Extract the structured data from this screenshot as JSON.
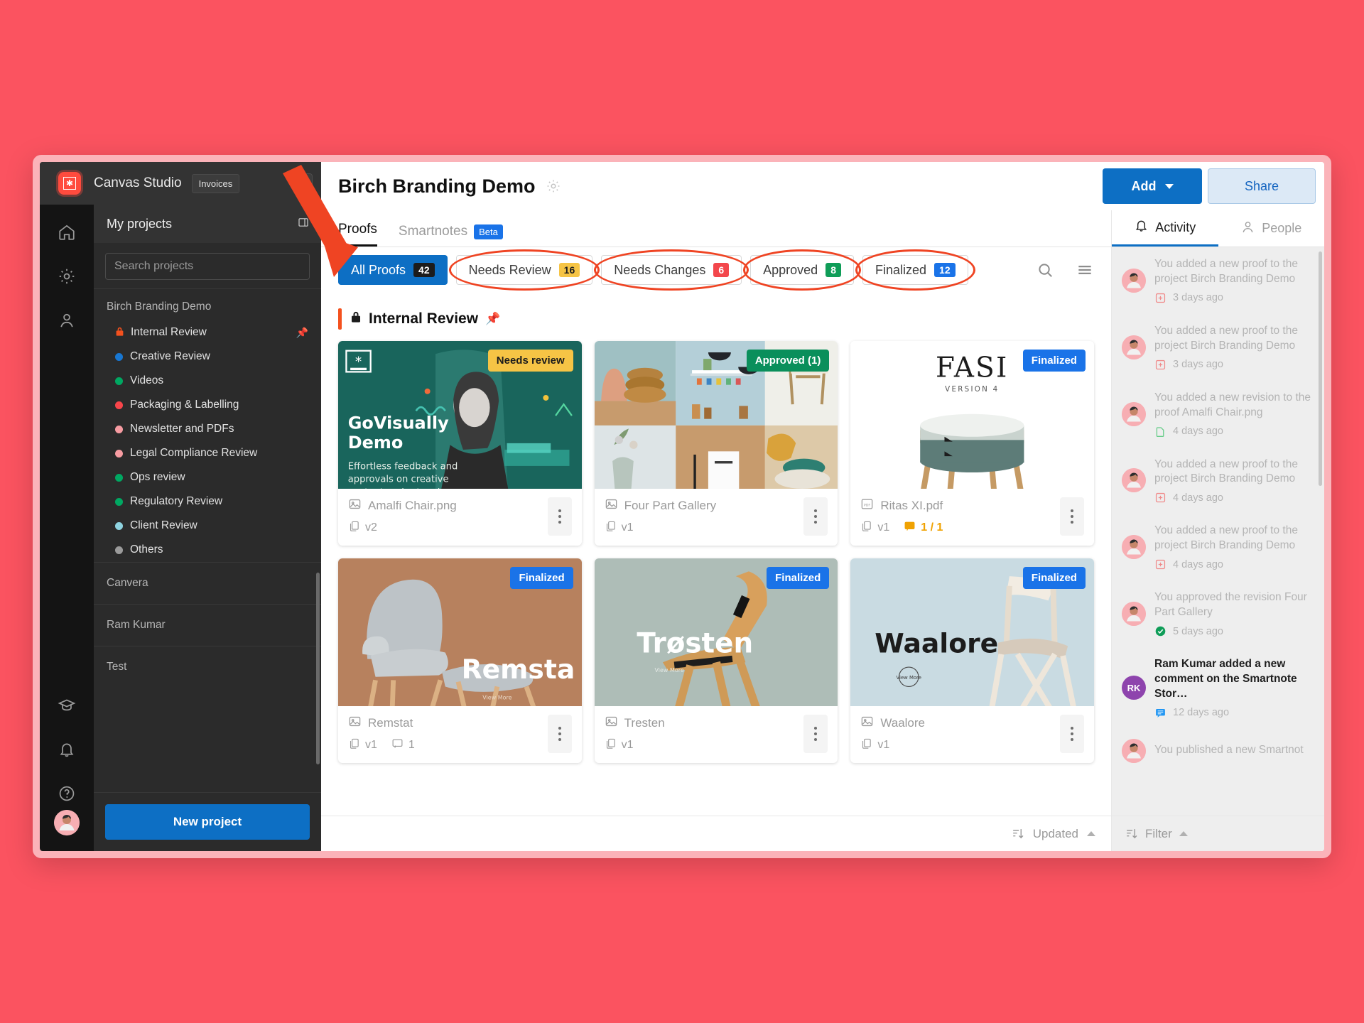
{
  "brand": {
    "name": "Canvas Studio",
    "chip": "Invoices",
    "logo_icon": "asterisk-logo-icon"
  },
  "sidebar": {
    "my_projects_label": "My projects",
    "search_placeholder": "Search projects",
    "groups": [
      {
        "title": "Birch Branding Demo",
        "folders": [
          {
            "label": "Internal Review",
            "color": "#f4511e",
            "icon": "lock-icon",
            "pinned": true
          },
          {
            "label": "Creative Review",
            "color": "#1877d2",
            "icon": "dot-icon",
            "pinned": false
          },
          {
            "label": "Videos",
            "color": "#00a862",
            "icon": "dot-icon",
            "pinned": false
          },
          {
            "label": "Packaging & Labelling",
            "color": "#f8454a",
            "icon": "dot-icon",
            "pinned": false
          },
          {
            "label": "Newsletter and PDFs",
            "color": "#f79ca2",
            "icon": "dot-icon",
            "pinned": false
          },
          {
            "label": "Legal Compliance Review",
            "color": "#f79ca2",
            "icon": "dot-icon",
            "pinned": false
          },
          {
            "label": "Ops review",
            "color": "#00a862",
            "icon": "dot-icon",
            "pinned": false
          },
          {
            "label": "Regulatory Review",
            "color": "#00a862",
            "icon": "dot-icon",
            "pinned": false
          },
          {
            "label": "Client Review",
            "color": "#8ed3e0",
            "icon": "dot-icon",
            "pinned": false
          },
          {
            "label": "Others",
            "color": "#9b9b9b",
            "icon": "dot-icon",
            "pinned": false
          }
        ]
      }
    ],
    "other_projects": [
      "Canvera",
      "Ram Kumar",
      "Test"
    ],
    "new_project_label": "New project"
  },
  "header": {
    "title": "Birch Branding Demo",
    "gear_icon": "gear-icon",
    "add_label": "Add",
    "share_label": "Share"
  },
  "tabs": [
    {
      "label": "Proofs",
      "active": true,
      "badge": ""
    },
    {
      "label": "Smartnotes",
      "active": false,
      "badge": "Beta"
    }
  ],
  "filters": [
    {
      "label": "All Proofs",
      "count": "42",
      "count_color": "#1c1c1c",
      "active": true,
      "circled": false
    },
    {
      "label": "Needs Review",
      "count": "16",
      "count_color": "#f6c445",
      "active": false,
      "circled": true
    },
    {
      "label": "Needs Changes",
      "count": "6",
      "count_color": "#f3474c",
      "active": false,
      "circled": true
    },
    {
      "label": "Approved",
      "count": "8",
      "count_color": "#0f9d58",
      "active": false,
      "circled": true
    },
    {
      "label": "Finalized",
      "count": "12",
      "count_color": "#1a73e8",
      "active": false,
      "circled": true
    }
  ],
  "filters_tools": {
    "search_icon": "search-icon",
    "list_view_icon": "list-view-icon"
  },
  "section": {
    "title": "Internal Review",
    "lock_icon": "lock-icon",
    "pin_icon": "pin-icon"
  },
  "cards": [
    {
      "name": "Amalfi Chair.png",
      "version": "v2",
      "comments": "",
      "file_icon": "image-file-icon",
      "status": {
        "label": "Needs review",
        "bg": "#f6c445",
        "fg": "#1c1c1c"
      },
      "art": "govisually-demo"
    },
    {
      "name": "Four Part Gallery",
      "version": "v1",
      "comments": "",
      "file_icon": "image-file-icon",
      "status": {
        "label": "Approved (1)",
        "bg": "#0a8f5b",
        "fg": "#ffffff"
      },
      "art": "four-part-gallery"
    },
    {
      "name": "Ritas XI.pdf",
      "version": "v1",
      "comments": "1 / 1",
      "file_icon": "pdf-file-icon",
      "status": {
        "label": "Finalized",
        "bg": "#1a73e8",
        "fg": "#ffffff"
      },
      "art": "fasi-stool",
      "art_title": "FASI",
      "art_sub": "VERSION 4"
    },
    {
      "name": "Remstat",
      "version": "v1",
      "comments": "1",
      "file_icon": "image-file-icon",
      "status": {
        "label": "Finalized",
        "bg": "#1a73e8",
        "fg": "#ffffff"
      },
      "art": "remsta-chair",
      "art_title": "Remsta"
    },
    {
      "name": "Tresten",
      "version": "v1",
      "comments": "",
      "file_icon": "image-file-icon",
      "status": {
        "label": "Finalized",
        "bg": "#1a73e8",
        "fg": "#ffffff"
      },
      "art": "trosten-chair",
      "art_title": "Trøsten"
    },
    {
      "name": "Waalore",
      "version": "v1",
      "comments": "",
      "file_icon": "image-file-icon",
      "status": {
        "label": "Finalized",
        "bg": "#1a73e8",
        "fg": "#ffffff"
      },
      "art": "waalore-chair",
      "art_title": "Waalore"
    }
  ],
  "footer": {
    "sort_label": "Updated",
    "sort_icon": "sort-icon"
  },
  "right_panel": {
    "tabs": [
      {
        "label": "Activity",
        "icon": "bell-icon",
        "active": true
      },
      {
        "label": "People",
        "icon": "person-icon",
        "active": false
      }
    ],
    "filter_label": "Filter",
    "activities": [
      {
        "text": "You added a new proof to the project Birch Branding Demo",
        "time": "3 days ago",
        "icon": "add-proof-icon",
        "avatar": "user-photo",
        "strong": false
      },
      {
        "text": "You added a new proof to the project Birch Branding Demo",
        "time": "3 days ago",
        "icon": "add-proof-icon",
        "avatar": "user-photo",
        "strong": false
      },
      {
        "text": "You added a new revision to the proof Amalfi Chair.png",
        "time": "4 days ago",
        "icon": "revision-icon",
        "avatar": "user-photo",
        "strong": false
      },
      {
        "text": "You added a new proof to the project Birch Branding Demo",
        "time": "4 days ago",
        "icon": "add-proof-icon",
        "avatar": "user-photo",
        "strong": false
      },
      {
        "text": "You added a new proof to the project Birch Branding Demo",
        "time": "4 days ago",
        "icon": "add-proof-icon",
        "avatar": "user-photo",
        "strong": false
      },
      {
        "text": "You approved the revision Four Part Gallery",
        "time": "5 days ago",
        "icon": "approved-check-icon",
        "avatar": "user-photo",
        "strong": false
      },
      {
        "text": "Ram Kumar added a new comment on the Smartnote Stor…",
        "time": "12 days ago",
        "icon": "comment-icon",
        "avatar": "RK",
        "strong": true
      },
      {
        "text": "You published a new Smartnot",
        "time": "",
        "icon": "",
        "avatar": "user-photo",
        "strong": false
      }
    ]
  },
  "annotation": {
    "arrow_color": "#ef4423",
    "ring_color": "#ef4423"
  }
}
